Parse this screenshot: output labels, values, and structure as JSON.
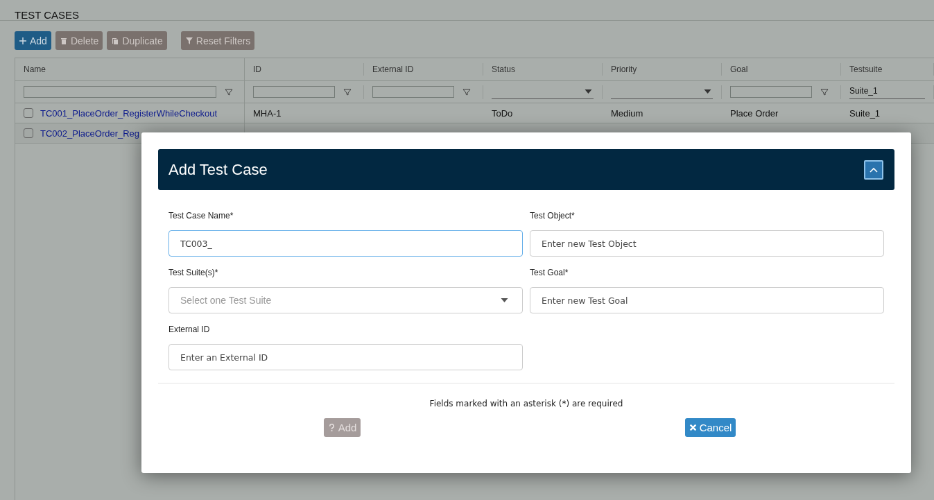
{
  "page": {
    "title": "TEST CASES"
  },
  "toolbar": [
    {
      "label": "Add",
      "kind": "add",
      "disabled": false
    },
    {
      "label": "Delete",
      "kind": "delete",
      "disabled": true
    },
    {
      "label": "Duplicate",
      "kind": "duplicate",
      "disabled": true
    },
    {
      "label": "Reset Filters",
      "kind": "reset",
      "disabled": true
    }
  ],
  "filter_bar": [
    {
      "kind": "text"
    },
    {
      "kind": "text"
    },
    {
      "kind": "text"
    },
    {
      "kind": "select"
    },
    {
      "kind": "select"
    },
    {
      "kind": "text"
    },
    {
      "kind": "value",
      "value": "Suite_1"
    }
  ],
  "table": {
    "columns": [
      "Name",
      "ID",
      "External ID",
      "Status",
      "Priority",
      "Goal",
      "Testsuite"
    ],
    "rows": [
      {
        "checked": false,
        "cells": [
          "TC001_PlaceOrder_RegisterWhileCheckout",
          "MHA-1",
          "",
          "ToDo",
          "Medium",
          "Place Order",
          "Suite_1"
        ]
      },
      {
        "checked": false,
        "cells": [
          "TC002_PlaceOrder_Reg"
        ]
      }
    ]
  },
  "dialog": {
    "title": "Add Test Case",
    "fields": [
      {
        "label": "Test Case Name*",
        "kind": "input",
        "value": "TC003_",
        "focused": true
      },
      {
        "label": "Test Object*",
        "kind": "input",
        "placeholder": "Enter new Test Object",
        "focused": false
      },
      {
        "label": "Test Suite(s)*",
        "kind": "select",
        "placeholder": "Select one Test Suite",
        "focused": false
      },
      {
        "label": "Test Goal*",
        "kind": "input",
        "placeholder": "Enter new Test Goal",
        "focused": false
      },
      {
        "label": "External ID",
        "kind": "input",
        "placeholder": "Enter an External ID",
        "focused": false
      }
    ],
    "note": "Fields marked with an asterisk (*) are required",
    "buttons": [
      {
        "label": "Add",
        "kind": "add",
        "disabled": true
      },
      {
        "label": "Cancel",
        "kind": "cancel",
        "disabled": false
      }
    ]
  }
}
